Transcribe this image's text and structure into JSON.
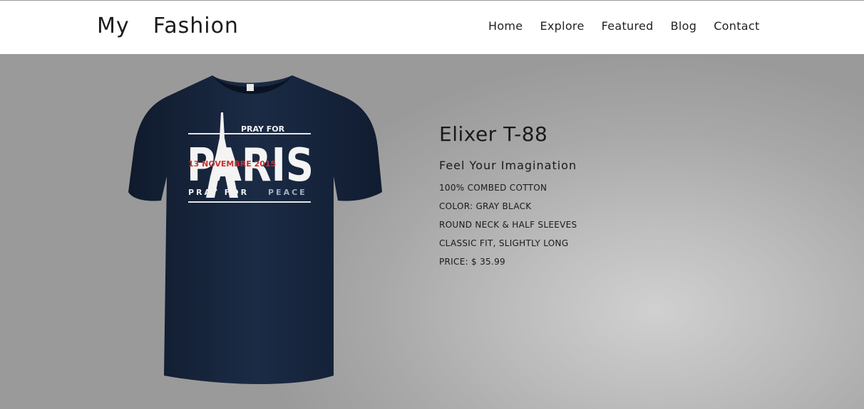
{
  "site": {
    "logo": "My  Fashion"
  },
  "nav": {
    "items": [
      {
        "label": "Home"
      },
      {
        "label": "Explore"
      },
      {
        "label": "Featured"
      },
      {
        "label": "Blog"
      },
      {
        "label": "Contact"
      }
    ]
  },
  "product": {
    "name": "Elixer T-88",
    "tagline": "Feel Your Imagination",
    "specs": [
      "100% COMBED COTTON",
      "COLOR: GRAY BLACK",
      "ROUND NECK & HALF SLEEVES",
      "CLASSIC FIT, SLIGHTLY LONG",
      "PRICE: $ 35.99"
    ],
    "image": {
      "pray_for": "PRAY FOR",
      "city": "PARIS",
      "date": "13 NOVEMBRE 2015",
      "pray_for_peace_a": "PRAY FOR",
      "pray_for_peace_b": "PEACE"
    }
  },
  "colors": {
    "shirt": "#16243a",
    "brand_text": "#1c1c1c"
  }
}
